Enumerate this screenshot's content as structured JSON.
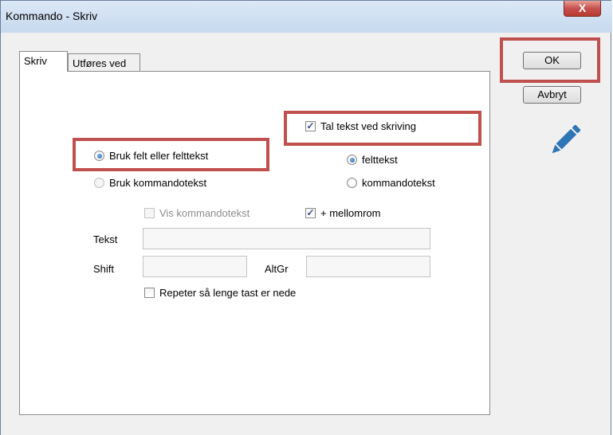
{
  "window": {
    "title": "Kommando - Skriv",
    "close_glyph": "X"
  },
  "tabs": [
    {
      "label": "Skriv"
    },
    {
      "label": "Utføres ved"
    }
  ],
  "buttons": {
    "ok": "OK",
    "cancel": "Avbryt"
  },
  "options": {
    "use_field_label": "Bruk felt eller felttekst",
    "use_command_label": "Bruk kommandotekst",
    "speak_label": "Tal tekst ved skriving",
    "fieldtext_label": "felttekst",
    "commandtext_label": "kommandotekst",
    "show_command_label": "Vis kommandotekst",
    "plus_space_label": "+ mellomrom",
    "repeat_label": "Repeter så lenge tast er nede"
  },
  "fields": {
    "text_label": "Tekst",
    "shift_label": "Shift",
    "altgr_label": "AltGr"
  },
  "icons": {
    "edit": "pencil-icon"
  },
  "colors": {
    "highlight": "#c0504d",
    "pencil": "#2e75b6"
  }
}
